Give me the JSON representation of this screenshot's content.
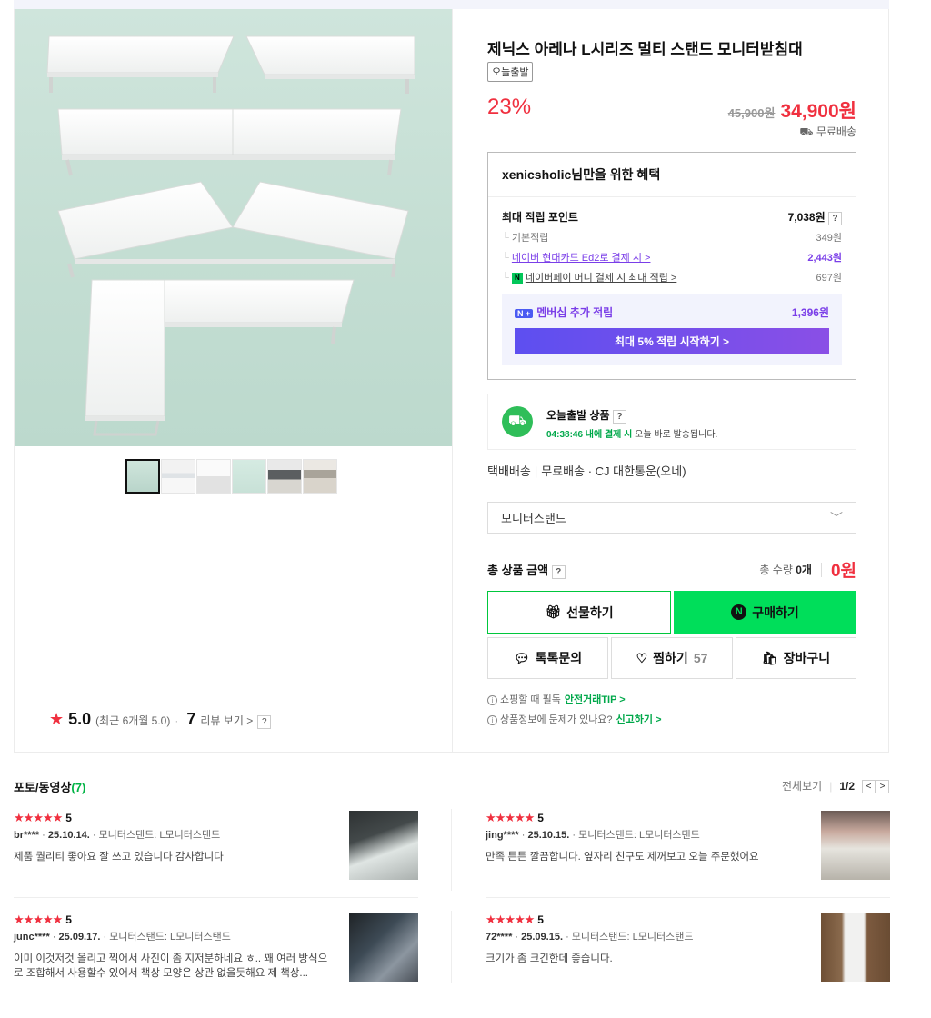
{
  "product": {
    "title": "제닉스 아레나 L시리즈 멀티 스탠드 모니터받침대",
    "badge": "오늘출발",
    "discount": "23%",
    "original_price": "45,900원",
    "price": "34,900원",
    "shipping": "무료배송"
  },
  "rating": {
    "score": "5.0",
    "recent": "(최근 6개월 5.0)",
    "count": "7",
    "review_link": "리뷰 보기 >",
    "help": "?"
  },
  "benefit": {
    "title": "xenicsholic님만을 위한 혜택",
    "max_points_label": "최대 적립 포인트",
    "max_points_value": "7,038원",
    "help": "?",
    "rows": [
      {
        "label": "기본적립",
        "value": "349원"
      },
      {
        "label": "네이버 현대카드 Ed2로 결제 시 >",
        "value": "2,443원"
      },
      {
        "label": "네이버페이 머니 결제 시 최대 적립 >",
        "value": "697원"
      }
    ],
    "npay_icon": "N",
    "membership_badge": "N +",
    "membership_label": "멤버십 추가 적립",
    "membership_value": "1,396원",
    "membership_button": "최대 5% 적립 시작하기 >"
  },
  "today_ship": {
    "title": "오늘출발 상품",
    "help": "?",
    "timer": "04:38:46 내에 결제 시",
    "sub": "오늘 바로 발송됩니다."
  },
  "delivery": {
    "method": "택배배송",
    "fee": "무료배송",
    "carrier": "CJ 대한통운(오네)"
  },
  "option": {
    "selected": "모니터스탠드"
  },
  "total": {
    "label": "총 상품 금액",
    "help": "?",
    "qty_label": "총 수량",
    "qty": "0개",
    "price": "0원"
  },
  "buttons": {
    "gift": "선물하기",
    "buy": "구매하기",
    "talk": "톡톡문의",
    "zzim": "찜하기",
    "zzim_count": "57",
    "cart": "장바구니"
  },
  "notices": [
    {
      "text": "쇼핑할 때 필독",
      "link": "안전거래TIP >"
    },
    {
      "text": "상품정보에 문제가 있나요?",
      "link": "신고하기 >"
    }
  ],
  "reviews_section": {
    "title": "포토/동영상",
    "count": "(7)",
    "view_all": "전체보기",
    "page": "1/2",
    "prev": "<",
    "next": ">"
  },
  "reviews": [
    {
      "stars": "★★★★★",
      "score": "5",
      "user": "br****",
      "date": "25.10.14.",
      "option": "모니터스탠드: L모니터스탠드",
      "body": "제품 퀄리티 좋아요 잘 쓰고 있습니다 감사합니다"
    },
    {
      "stars": "★★★★★",
      "score": "5",
      "user": "jing****",
      "date": "25.10.15.",
      "option": "모니터스탠드: L모니터스탠드",
      "body": "만족 튼튼 깔끔합니다. 옆자리 친구도 제꺼보고 오늘 주문했어요"
    },
    {
      "stars": "★★★★★",
      "score": "5",
      "user": "junc****",
      "date": "25.09.17.",
      "option": "모니터스탠드: L모니터스탠드",
      "body": "이미 이것저것 올리고 찍어서 사진이 좀 지저분하네요 ㅎ.. 꽤 여러 방식으로 조합해서 사용할수 있어서 책상 모양은 상관 없을듯해요 제 책상..."
    },
    {
      "stars": "★★★★★",
      "score": "5",
      "user": "72****",
      "date": "25.09.15.",
      "option": "모니터스탠드: L모니터스탠드",
      "body": "크기가 좀 크긴한데 좋습니다."
    }
  ]
}
